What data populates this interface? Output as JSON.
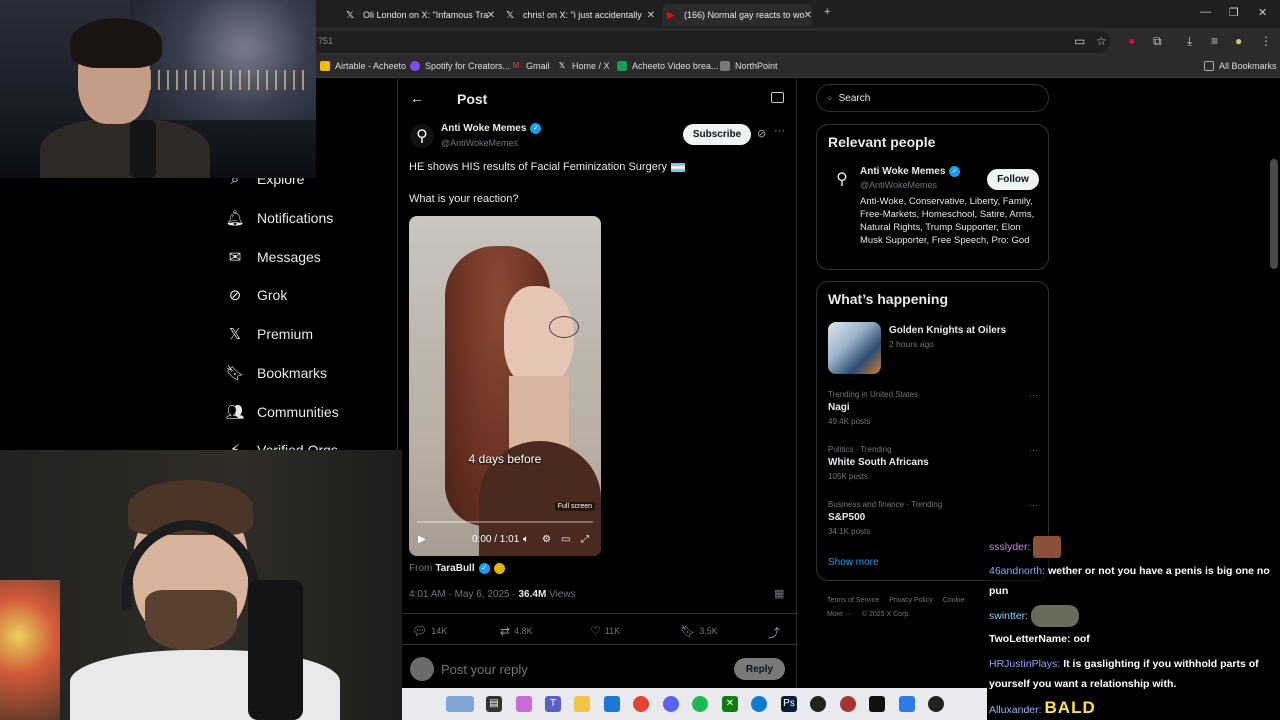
{
  "browser": {
    "tabs": [
      {
        "label": "Oli London on X: \"Infamous Tra",
        "icon": "x-icon"
      },
      {
        "label": "chris! on X: \"i just accidentally",
        "icon": "x-icon"
      },
      {
        "label": "(166) Normal gay reacts to wo",
        "icon": "youtube-icon"
      }
    ],
    "url_fragment": "751",
    "bookmarks": [
      {
        "label": "Airtable - Acheeto",
        "color": "#f9b800"
      },
      {
        "label": "Spotify for Creators...",
        "color": "#7c4dff"
      },
      {
        "label": "Gmail",
        "color": "#ea4335"
      },
      {
        "label": "Home / X",
        "color": "#000000"
      },
      {
        "label": "Acheeto Video brea...",
        "color": "#0f9d58"
      },
      {
        "label": "NorthPoint",
        "color": "#777777"
      }
    ],
    "all_bookmarks": "All Bookmarks"
  },
  "nav": [
    {
      "label": "Explore",
      "icon": "search-icon"
    },
    {
      "label": "Notifications",
      "icon": "bell-icon"
    },
    {
      "label": "Messages",
      "icon": "envelope-icon"
    },
    {
      "label": "Grok",
      "icon": "grok-icon"
    },
    {
      "label": "Premium",
      "icon": "x-logo-icon"
    },
    {
      "label": "Bookmarks",
      "icon": "bookmark-icon"
    },
    {
      "label": "Communities",
      "icon": "people-icon"
    },
    {
      "label": "Verified Orgs",
      "icon": "lightning-icon"
    }
  ],
  "post": {
    "header_title": "Post",
    "author_name": "Anti Woke Memes",
    "author_handle": "@AntiWokeMemes",
    "subscribe_label": "Subscribe",
    "text_line1": "HE shows HIS results of Facial Feminization Surgery",
    "text_line2": "What is your reaction?",
    "video": {
      "caption": "4 days before",
      "fullscreen_tip": "Full screen",
      "time": "0:00 / 1:01",
      "progress": 0.0
    },
    "from_label": "From",
    "from_user": "TaraBull",
    "timestamp": "4:01 AM · May 6, 2025 ·",
    "views_count": "36.4M",
    "views_label": "Views",
    "stats": {
      "replies": "14K",
      "reposts": "4.8K",
      "likes": "11K",
      "bookmarks": "3.5K"
    },
    "reply_placeholder": "Post your reply",
    "reply_button": "Reply"
  },
  "sidebar": {
    "search_placeholder": "Search",
    "relevant_title": "Relevant people",
    "person": {
      "name": "Anti Woke Memes",
      "handle": "@AntiWokeMemes",
      "follow_label": "Follow",
      "bio": "Anti-Woke, Conservative, Liberty, Family, Free-Markets, Homeschool, Satire, Arms, Natural Rights, Trump Supporter, Elon Musk Supporter, Free Speech, Pro: God"
    },
    "happening_title": "What’s happening",
    "highlight": {
      "title": "Golden Knights at Oilers",
      "time": "2 hours ago"
    },
    "trends": [
      {
        "context": "Trending in United States",
        "name": "Nagi",
        "count": "49.4K posts"
      },
      {
        "context": "Politics · Trending",
        "name": "White South Africans",
        "count": "105K posts"
      },
      {
        "context": "Business and finance · Trending",
        "name": "S&P500",
        "count": "34.1K posts"
      }
    ],
    "show_more": "Show more",
    "footer": [
      "Terms of Service",
      "Privacy Policy",
      "Cookie"
    ],
    "footer2": [
      "More ···",
      "© 2025 X Corp."
    ]
  },
  "chat": [
    {
      "user": "ssslyder:",
      "text": ""
    },
    {
      "user": "46andnorth:",
      "text": "wether or not you have a penis is big one no pun"
    },
    {
      "user": "swintter:",
      "text": ""
    },
    {
      "user": "TwoLetterName:",
      "text": "oof"
    },
    {
      "user": "HRJustinPlays:",
      "text": "It is gaslighting if you withhold parts of yourself you want a relationship with."
    },
    {
      "user": "Alluxander:",
      "text": "BALD"
    }
  ],
  "colors": {
    "accent": "#1d9bf0",
    "background": "#000000",
    "border": "#2f3336",
    "muted": "#71767b"
  }
}
